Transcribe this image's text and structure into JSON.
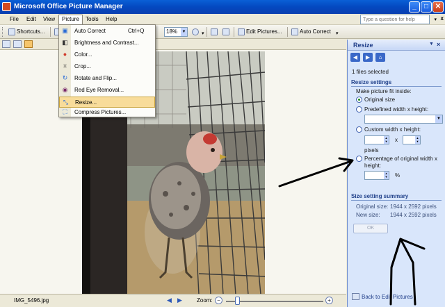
{
  "window": {
    "title": "Microsoft Office Picture Manager",
    "minimize": "_",
    "maximize": "□",
    "close": "✕"
  },
  "menubar": {
    "items": [
      {
        "label": "File"
      },
      {
        "label": "Edit"
      },
      {
        "label": "View"
      },
      {
        "label": "Picture"
      },
      {
        "label": "Tools"
      },
      {
        "label": "Help"
      }
    ],
    "help_placeholder": "Type a question for help",
    "doc_close": "x"
  },
  "toolbar": {
    "shortcuts": "Shortcuts...",
    "zoom_value": "18%",
    "edit_pictures": "Edit Pictures...",
    "auto_correct": "Auto Correct"
  },
  "picture_menu": {
    "items": [
      {
        "label": "Auto Correct",
        "shortcut": "Ctrl+Q",
        "icon": "auto-correct-icon"
      },
      {
        "label": "Brightness and Contrast...",
        "icon": "brightness-icon"
      },
      {
        "label": "Color...",
        "icon": "color-icon"
      },
      {
        "label": "Crop...",
        "icon": "crop-icon"
      },
      {
        "label": "Rotate and Flip...",
        "icon": "rotate-icon"
      },
      {
        "label": "Red Eye Removal...",
        "icon": "red-eye-icon"
      },
      {
        "label": "Resize...",
        "icon": "resize-icon",
        "highlighted": true
      },
      {
        "label": "Compress Pictures...",
        "icon": "compress-icon"
      }
    ]
  },
  "statusbar": {
    "filename": "IMG_5496.jpg",
    "zoom_label": "Zoom:",
    "zoom_level": 0.1
  },
  "pane": {
    "title": "Resize",
    "files_selected": "1 files selected",
    "settings_heading": "Resize settings",
    "fit_label": "Make picture fit inside:",
    "option_original": "Original size",
    "option_predefined": "Predefined width x height:",
    "option_custom": "Custom width x height:",
    "times": "x",
    "pixels": "pixels",
    "option_percentage_line1": "Percentage of original width x",
    "option_percentage_line2": "height:",
    "percent_sign": "%",
    "summary_heading": "Size setting summary",
    "original_size_label": "Original size:",
    "original_size_value": "1944 x 2592 pixels",
    "new_size_label": "New size:",
    "new_size_value": "1944 x 2592 pixels",
    "ok": "OK",
    "back_link": "Back to Edit Pictures"
  },
  "colors": {
    "title_bar": "#0449c0",
    "pane_background": "#d9e6fb",
    "menu_highlight": "#f8dc9a",
    "annotation": "#000000"
  }
}
